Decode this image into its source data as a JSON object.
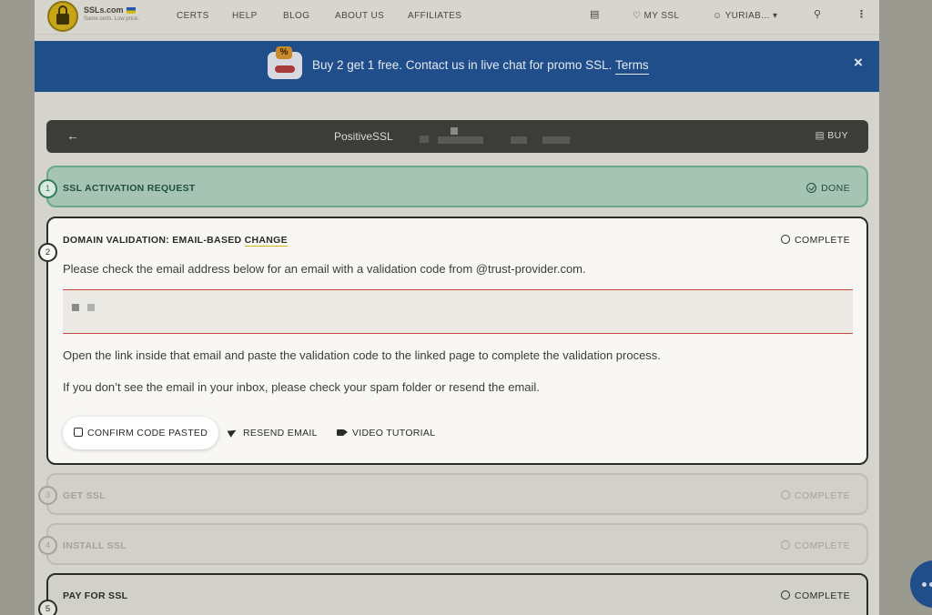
{
  "header": {
    "brand": "SSLs.com",
    "tagline": "Same certs. Low price.",
    "nav": [
      "CERTS",
      "HELP",
      "BLOG",
      "ABOUT US",
      "AFFILIATES"
    ],
    "my_ssl": "MY SSL",
    "user": "YURIAB..."
  },
  "promo": {
    "text": "Buy 2 get 1 free. Contact us in live chat for promo SSL.",
    "link": "Terms",
    "close": "×"
  },
  "product": {
    "name": "PositiveSSL",
    "buy": "BUY"
  },
  "steps": [
    {
      "number": "1",
      "title": "SSL ACTIVATION REQUEST",
      "status": "DONE"
    },
    {
      "number": "2",
      "title_prefix": "DOMAIN VALIDATION: EMAIL-BASED ",
      "title_highlight": "CHANGE",
      "status": "COMPLETE",
      "intro": "Please check the email address below for an email with a validation code from @trust-provider.com.",
      "instructions": "Open the link inside that email and paste the validation code to the linked page to complete the validation process.",
      "spam_note": "If you don’t see the email in your inbox, please check your spam folder or resend the email.",
      "actions": {
        "confirm": "CONFIRM CODE PASTED",
        "resend": "RESEND EMAIL",
        "video": "VIDEO TUTORIAL"
      }
    },
    {
      "number": "3",
      "title": "GET SSL",
      "status": "COMPLETE"
    },
    {
      "number": "4",
      "title": "INSTALL SSL",
      "status": "COMPLETE"
    },
    {
      "number": "5",
      "title": "PAY FOR SSL",
      "status": "COMPLETE"
    }
  ]
}
